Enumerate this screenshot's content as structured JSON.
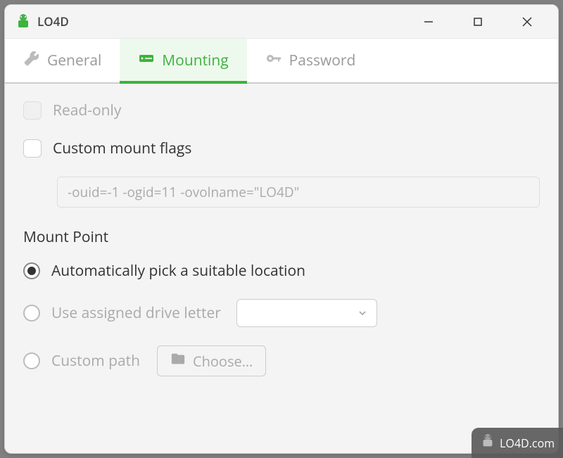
{
  "window": {
    "title": "LO4D"
  },
  "tabs": {
    "general": "General",
    "mounting": "Mounting",
    "password": "Password"
  },
  "mounting": {
    "read_only_label": "Read-only",
    "custom_flags_label": "Custom mount flags",
    "custom_flags_value": "-ouid=-1 -ogid=11 -ovolname=\"LO4D\"",
    "mount_point_label": "Mount Point",
    "radio_auto": "Automatically pick a suitable location",
    "radio_drive": "Use assigned drive letter",
    "radio_custom": "Custom path",
    "choose_btn": "Choose…"
  },
  "watermark": "LO4D.com"
}
